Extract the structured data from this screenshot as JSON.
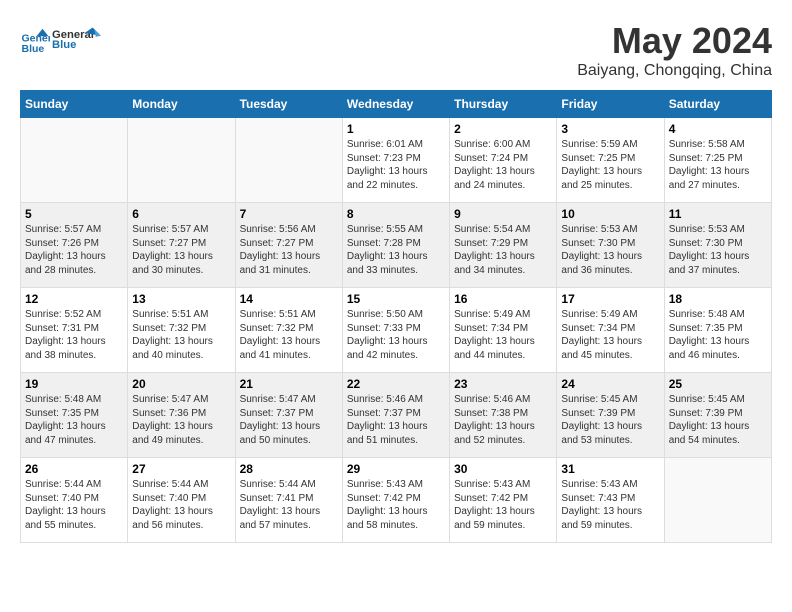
{
  "logo": {
    "line1": "General",
    "line2": "Blue"
  },
  "title": "May 2024",
  "subtitle": "Baiyang, Chongqing, China",
  "weekdays": [
    "Sunday",
    "Monday",
    "Tuesday",
    "Wednesday",
    "Thursday",
    "Friday",
    "Saturday"
  ],
  "weeks": [
    [
      {
        "day": "",
        "info": ""
      },
      {
        "day": "",
        "info": ""
      },
      {
        "day": "",
        "info": ""
      },
      {
        "day": "1",
        "info": "Sunrise: 6:01 AM\nSunset: 7:23 PM\nDaylight: 13 hours\nand 22 minutes."
      },
      {
        "day": "2",
        "info": "Sunrise: 6:00 AM\nSunset: 7:24 PM\nDaylight: 13 hours\nand 24 minutes."
      },
      {
        "day": "3",
        "info": "Sunrise: 5:59 AM\nSunset: 7:25 PM\nDaylight: 13 hours\nand 25 minutes."
      },
      {
        "day": "4",
        "info": "Sunrise: 5:58 AM\nSunset: 7:25 PM\nDaylight: 13 hours\nand 27 minutes."
      }
    ],
    [
      {
        "day": "5",
        "info": "Sunrise: 5:57 AM\nSunset: 7:26 PM\nDaylight: 13 hours\nand 28 minutes."
      },
      {
        "day": "6",
        "info": "Sunrise: 5:57 AM\nSunset: 7:27 PM\nDaylight: 13 hours\nand 30 minutes."
      },
      {
        "day": "7",
        "info": "Sunrise: 5:56 AM\nSunset: 7:27 PM\nDaylight: 13 hours\nand 31 minutes."
      },
      {
        "day": "8",
        "info": "Sunrise: 5:55 AM\nSunset: 7:28 PM\nDaylight: 13 hours\nand 33 minutes."
      },
      {
        "day": "9",
        "info": "Sunrise: 5:54 AM\nSunset: 7:29 PM\nDaylight: 13 hours\nand 34 minutes."
      },
      {
        "day": "10",
        "info": "Sunrise: 5:53 AM\nSunset: 7:30 PM\nDaylight: 13 hours\nand 36 minutes."
      },
      {
        "day": "11",
        "info": "Sunrise: 5:53 AM\nSunset: 7:30 PM\nDaylight: 13 hours\nand 37 minutes."
      }
    ],
    [
      {
        "day": "12",
        "info": "Sunrise: 5:52 AM\nSunset: 7:31 PM\nDaylight: 13 hours\nand 38 minutes."
      },
      {
        "day": "13",
        "info": "Sunrise: 5:51 AM\nSunset: 7:32 PM\nDaylight: 13 hours\nand 40 minutes."
      },
      {
        "day": "14",
        "info": "Sunrise: 5:51 AM\nSunset: 7:32 PM\nDaylight: 13 hours\nand 41 minutes."
      },
      {
        "day": "15",
        "info": "Sunrise: 5:50 AM\nSunset: 7:33 PM\nDaylight: 13 hours\nand 42 minutes."
      },
      {
        "day": "16",
        "info": "Sunrise: 5:49 AM\nSunset: 7:34 PM\nDaylight: 13 hours\nand 44 minutes."
      },
      {
        "day": "17",
        "info": "Sunrise: 5:49 AM\nSunset: 7:34 PM\nDaylight: 13 hours\nand 45 minutes."
      },
      {
        "day": "18",
        "info": "Sunrise: 5:48 AM\nSunset: 7:35 PM\nDaylight: 13 hours\nand 46 minutes."
      }
    ],
    [
      {
        "day": "19",
        "info": "Sunrise: 5:48 AM\nSunset: 7:35 PM\nDaylight: 13 hours\nand 47 minutes."
      },
      {
        "day": "20",
        "info": "Sunrise: 5:47 AM\nSunset: 7:36 PM\nDaylight: 13 hours\nand 49 minutes."
      },
      {
        "day": "21",
        "info": "Sunrise: 5:47 AM\nSunset: 7:37 PM\nDaylight: 13 hours\nand 50 minutes."
      },
      {
        "day": "22",
        "info": "Sunrise: 5:46 AM\nSunset: 7:37 PM\nDaylight: 13 hours\nand 51 minutes."
      },
      {
        "day": "23",
        "info": "Sunrise: 5:46 AM\nSunset: 7:38 PM\nDaylight: 13 hours\nand 52 minutes."
      },
      {
        "day": "24",
        "info": "Sunrise: 5:45 AM\nSunset: 7:39 PM\nDaylight: 13 hours\nand 53 minutes."
      },
      {
        "day": "25",
        "info": "Sunrise: 5:45 AM\nSunset: 7:39 PM\nDaylight: 13 hours\nand 54 minutes."
      }
    ],
    [
      {
        "day": "26",
        "info": "Sunrise: 5:44 AM\nSunset: 7:40 PM\nDaylight: 13 hours\nand 55 minutes."
      },
      {
        "day": "27",
        "info": "Sunrise: 5:44 AM\nSunset: 7:40 PM\nDaylight: 13 hours\nand 56 minutes."
      },
      {
        "day": "28",
        "info": "Sunrise: 5:44 AM\nSunset: 7:41 PM\nDaylight: 13 hours\nand 57 minutes."
      },
      {
        "day": "29",
        "info": "Sunrise: 5:43 AM\nSunset: 7:42 PM\nDaylight: 13 hours\nand 58 minutes."
      },
      {
        "day": "30",
        "info": "Sunrise: 5:43 AM\nSunset: 7:42 PM\nDaylight: 13 hours\nand 59 minutes."
      },
      {
        "day": "31",
        "info": "Sunrise: 5:43 AM\nSunset: 7:43 PM\nDaylight: 13 hours\nand 59 minutes."
      },
      {
        "day": "",
        "info": ""
      }
    ]
  ]
}
